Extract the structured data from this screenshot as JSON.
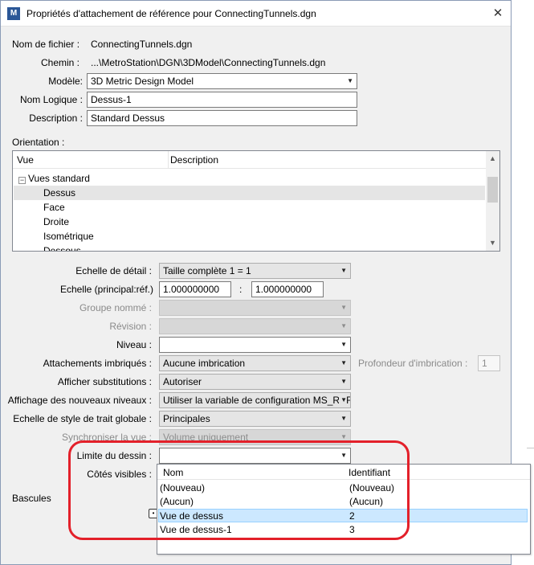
{
  "window": {
    "title": "Propriétés d'attachement de référence pour ConnectingTunnels.dgn",
    "app_icon": "M",
    "close_glyph": "✕"
  },
  "file": {
    "name_label": "Nom de fichier :",
    "name_value": "ConnectingTunnels.dgn",
    "path_label": "Chemin :",
    "path_value": "...\\MetroStation\\DGN\\3DModel\\ConnectingTunnels.dgn",
    "model_label": "Modèle:",
    "model_value": "3D Metric Design Model",
    "logical_label": "Nom Logique :",
    "logical_value": "Dessus-1",
    "desc_label": "Description :",
    "desc_value": "Standard Dessus"
  },
  "orientation": {
    "label": "Orientation :",
    "col_view": "Vue",
    "col_desc": "Description",
    "group": "Vues standard",
    "items": [
      "Dessus",
      "Face",
      "Droite",
      "Isométrique",
      "Dessous"
    ],
    "selected": "Dessus"
  },
  "settings": {
    "detail_scale_label": "Echelle de détail :",
    "detail_scale_value": "Taille complète 1 = 1",
    "scale_label": "Echelle (principal:réf.)",
    "scale_master": "1.000000000",
    "scale_sep": ":",
    "scale_ref": "1.000000000",
    "named_group_label": "Groupe nommé :",
    "revision_label": "Révision :",
    "level_label": "Niveau :",
    "nested_label": "Attachements imbriqués :",
    "nested_value": "Aucune imbrication",
    "nest_depth_label": "Profondeur d'imbrication :",
    "nest_depth_value": "1",
    "display_overrides_label": "Afficher substitutions :",
    "display_overrides_value": "Autoriser",
    "new_level_label": "Affichage des nouveaux niveaux :",
    "new_level_value": "Utiliser la variable de configuration MS_REF",
    "line_style_label": "Echelle de style de trait globale :",
    "line_style_value": "Principales",
    "sync_view_label": "Synchroniser la vue :",
    "sync_view_value": "Volume uniquement",
    "drawing_limit_label": "Limite du dessin :",
    "visible_edges_label": "Côtés visibles :",
    "toggles_label": "Bascules"
  },
  "popup": {
    "col_name": "Nom",
    "col_id": "Identifiant",
    "rows": [
      {
        "name": "(Nouveau)",
        "id": "(Nouveau)"
      },
      {
        "name": "(Aucun)",
        "id": "(Aucun)"
      },
      {
        "name": "Vue de dessus",
        "id": "2"
      },
      {
        "name": "Vue de dessus-1",
        "id": "3"
      }
    ],
    "selected": "Vue de dessus"
  },
  "colors": {
    "annotation_red": "#e3202a",
    "selection_blue": "#cce8ff"
  }
}
